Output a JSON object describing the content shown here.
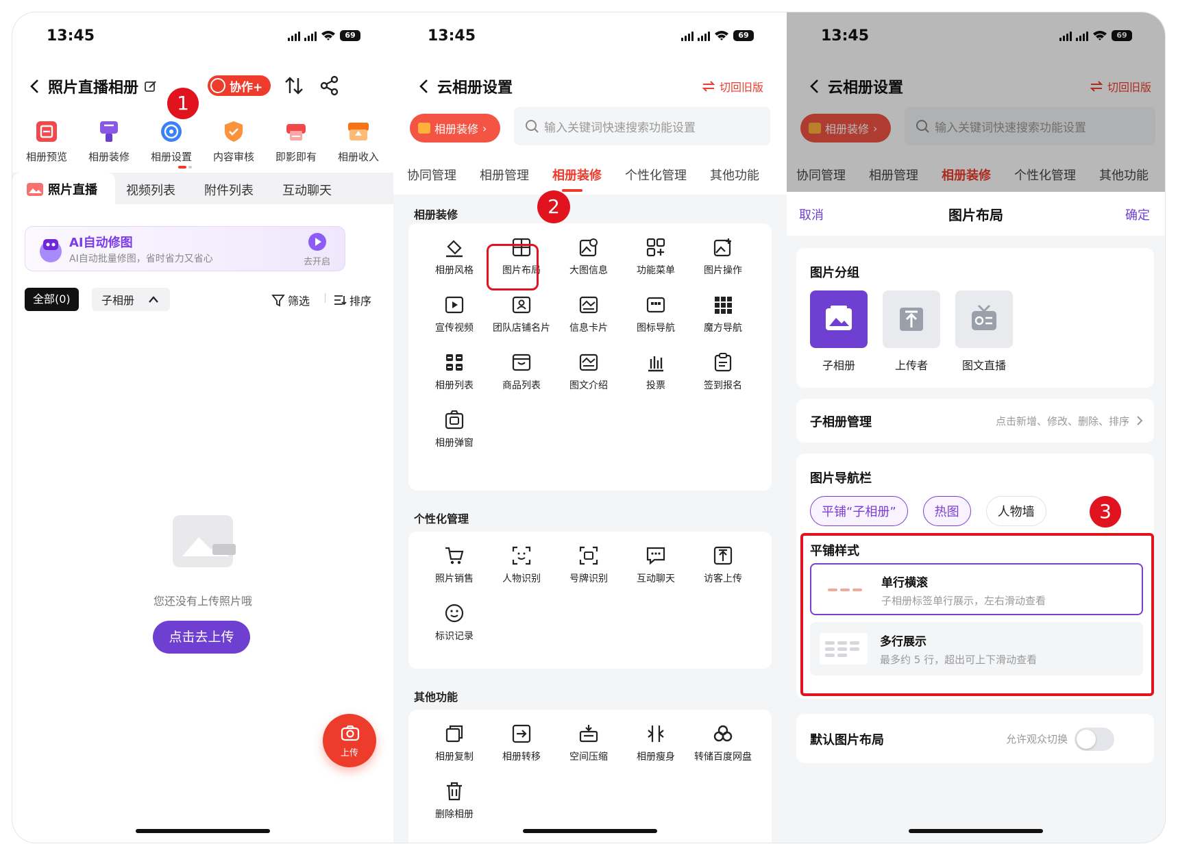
{
  "status": {
    "time": "13:45",
    "battery": "69"
  },
  "colors": {
    "accent_red": "#ee3c2c",
    "purple": "#6e3fd0",
    "annotation_red": "#e0131f"
  },
  "p1": {
    "title": "照片直播相册",
    "collab_label": "协作+",
    "step_badge": "1",
    "toolbar": [
      "相册预览",
      "相册装修",
      "相册设置",
      "内容审核",
      "即影即有",
      "相册收入"
    ],
    "tabs": [
      "照片直播",
      "视频列表",
      "附件列表",
      "互动聊天"
    ],
    "ai_banner": {
      "title": "AI自动修图",
      "subtitle": "AI自动批量修图，省时省力又省心",
      "action": "去开启"
    },
    "filter": {
      "all": "全部(0)",
      "sub": "子相册",
      "screen": "筛选",
      "sort": "排序"
    },
    "empty_text": "您还没有上传照片哦",
    "upload_button": "点击去上传",
    "fab_label": "上传"
  },
  "p2": {
    "title": "云相册设置",
    "switch_old": "切回旧版",
    "pill": "相册装修",
    "search_placeholder": "输入关键词快速搜索功能设置",
    "tabs": [
      "协同管理",
      "相册管理",
      "相册装修",
      "个性化管理",
      "其他功能"
    ],
    "step_badge": "2",
    "section_decor": "相册装修",
    "decor_items": [
      "相册风格",
      "图片布局",
      "大图信息",
      "功能菜单",
      "图片操作",
      "宣传视频",
      "团队店铺名片",
      "信息卡片",
      "图标导航",
      "魔方导航",
      "相册列表",
      "商品列表",
      "图文介绍",
      "投票",
      "签到报名",
      "相册弹窗"
    ],
    "section_personal": "个性化管理",
    "personal_items": [
      "照片销售",
      "人物识别",
      "号牌识别",
      "互动聊天",
      "访客上传",
      "标识记录"
    ],
    "section_other": "其他功能",
    "other_items": [
      "相册复制",
      "相册转移",
      "空间压缩",
      "相册瘦身",
      "转储百度网盘",
      "删除相册"
    ]
  },
  "p3": {
    "title": "云相册设置",
    "switch_old": "切回旧版",
    "pill": "相册装修",
    "search_placeholder": "输入关键词快速搜索功能设置",
    "tabs": [
      "协同管理",
      "相册管理",
      "相册装修",
      "个性化管理",
      "其他功能"
    ],
    "sheet": {
      "cancel": "取消",
      "title": "图片布局",
      "confirm": "确定"
    },
    "group": {
      "title": "图片分组",
      "options": [
        "子相册",
        "上传者",
        "图文直播"
      ]
    },
    "sub_manage": {
      "title": "子相册管理",
      "hint": "点击新增、修改、删除、排序"
    },
    "navbar": {
      "title": "图片导航栏",
      "chips": [
        "平铺“子相册”",
        "热图",
        "人物墙"
      ]
    },
    "step_badge": "3",
    "tile_style": {
      "title": "平铺样式",
      "options": [
        {
          "name": "单行横滚",
          "desc": "子相册标签单行展示，左右滑动查看"
        },
        {
          "name": "多行展示",
          "desc": "最多约 5 行，超出可上下滑动查看"
        }
      ]
    },
    "default_layout": {
      "title": "默认图片布局",
      "hint": "允许观众切换"
    }
  }
}
